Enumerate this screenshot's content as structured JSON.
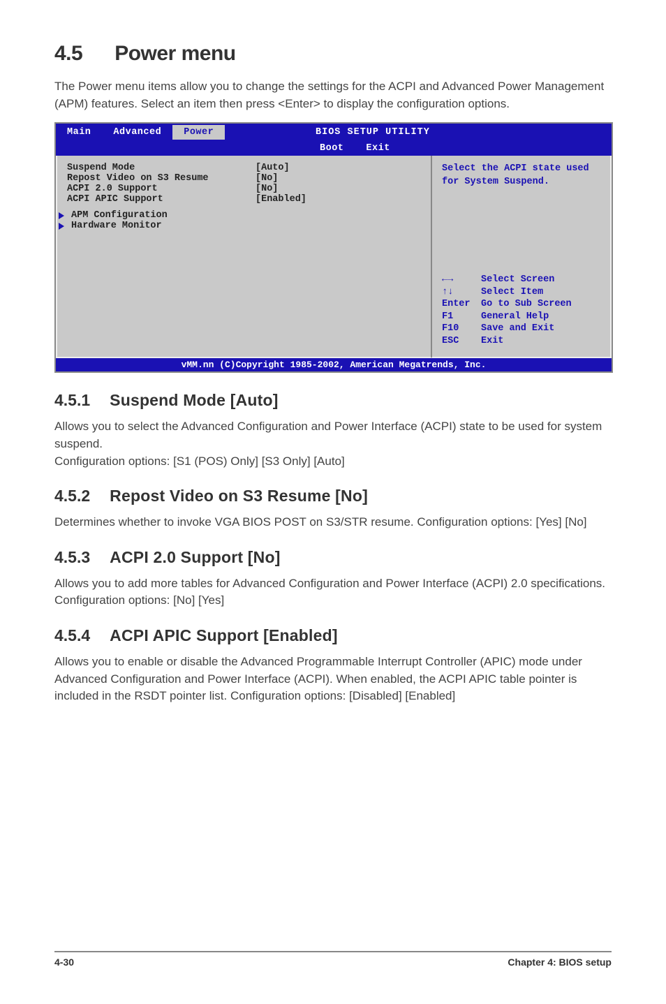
{
  "header": {
    "num": "4.5",
    "title": "Power menu"
  },
  "intro": "The Power menu items allow you to change the settings for the ACPI and Advanced Power Management (APM) features. Select an item then press <Enter> to display the configuration options.",
  "bios": {
    "util_title": "BIOS SETUP UTILITY",
    "tabs": {
      "main": "Main",
      "advanced": "Advanced",
      "power": "Power",
      "boot": "Boot",
      "exit": "Exit"
    },
    "items": {
      "suspend": {
        "label": "Suspend Mode",
        "value": "[Auto]"
      },
      "repost": {
        "label": "Repost Video on S3 Resume",
        "value": "[No]"
      },
      "acpi20": {
        "label": "ACPI 2.0 Support",
        "value": "[No]"
      },
      "apic": {
        "label": "ACPI APIC Support",
        "value": "[Enabled]"
      },
      "apm": {
        "label": "APM Configuration"
      },
      "hwmon": {
        "label": "Hardware Monitor"
      }
    },
    "help": "Select the ACPI state used for System Suspend.",
    "keys": {
      "lr": {
        "k": "←→",
        "d": "Select Screen"
      },
      "ud": {
        "k": "↑↓",
        "d": "Select Item"
      },
      "enter": {
        "k": "Enter",
        "d": "Go to Sub Screen"
      },
      "f1": {
        "k": "F1",
        "d": "General Help"
      },
      "f10": {
        "k": "F10",
        "d": "Save and Exit"
      },
      "esc": {
        "k": "ESC",
        "d": "Exit"
      }
    },
    "copyright": "vMM.nn (C)Copyright 1985-2002, American Megatrends, Inc."
  },
  "sections": {
    "s451": {
      "num": "4.5.1",
      "title": "Suspend Mode [Auto]",
      "body": "Allows you to select the Advanced Configuration and Power Interface (ACPI) state to be used for system suspend.\nConfiguration options: [S1 (POS) Only] [S3 Only] [Auto]"
    },
    "s452": {
      "num": "4.5.2",
      "title": "Repost Video on S3 Resume [No]",
      "body": "Determines whether to invoke VGA BIOS POST on S3/STR resume. Configuration options: [Yes] [No]"
    },
    "s453": {
      "num": "4.5.3",
      "title": "ACPI 2.0 Support [No]",
      "body": "Allows you to add more tables for Advanced Configuration and Power Interface (ACPI) 2.0 specifications. Configuration options: [No] [Yes]"
    },
    "s454": {
      "num": "4.5.4",
      "title": "ACPI APIC Support [Enabled]",
      "body": "Allows you to enable or disable the Advanced  Programmable Interrupt Controller (APIC) mode under Advanced Configuration and Power Interface (ACPI). When enabled, the ACPI APIC table pointer is included in the RSDT pointer list. Configuration options: [Disabled] [Enabled]"
    }
  },
  "footer": {
    "left": "4-30",
    "right": "Chapter 4: BIOS setup"
  }
}
